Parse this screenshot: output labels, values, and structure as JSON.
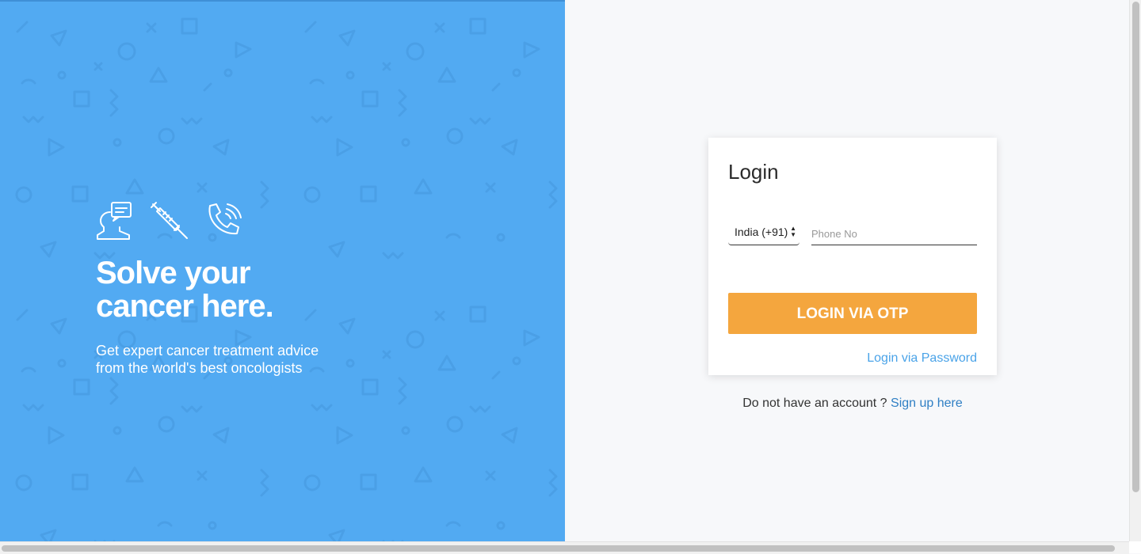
{
  "hero": {
    "title_line1": "Solve your",
    "title_line2": "cancer here.",
    "subtitle_line1": "Get expert cancer treatment advice",
    "subtitle_line2": "from the world's best oncologists",
    "icons": [
      "consultation-icon",
      "syringe-icon",
      "phone-call-icon"
    ]
  },
  "login": {
    "title": "Login",
    "country_selected": "India (+91)",
    "phone_placeholder": "Phone No",
    "phone_value": "",
    "otp_button": "LOGIN VIA OTP",
    "password_link": "Login via Password"
  },
  "signup": {
    "prompt": "Do not have an account ?",
    "link": "Sign up here"
  },
  "colors": {
    "left_panel": "#52aaf2",
    "otp_button": "#f4a63e",
    "link": "#4aa3e8"
  }
}
